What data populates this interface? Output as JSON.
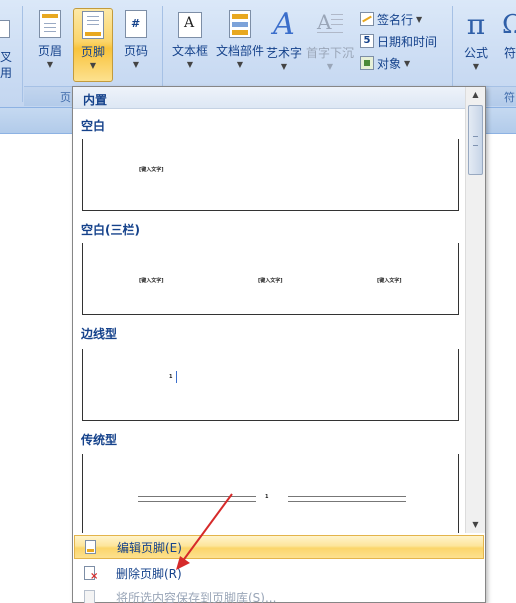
{
  "ribbon": {
    "left_cut_labels": [
      "叉",
      "用"
    ],
    "buttons": {
      "header": "页眉",
      "footer": "页脚",
      "page_number": "页码",
      "textbox": "文本框",
      "quick_parts": "文档部件",
      "wordart": "艺术字",
      "dropcap": "首字下沉",
      "equation": "公式",
      "symbol_cut": "符"
    },
    "small_buttons": {
      "signature_line": "签名行",
      "date_time": "日期和时间",
      "object": "对象"
    },
    "group_labels": {
      "header_footer_cut": "页",
      "symbols_cut": "符"
    }
  },
  "dropdown": {
    "header": "内置",
    "sections": [
      {
        "title": "空白",
        "placeholders": [
          "[键入文字]"
        ]
      },
      {
        "title": "空白(三栏)",
        "placeholders": [
          "[键入文字]",
          "[键入文字]",
          "[键入文字]"
        ]
      },
      {
        "title": "边线型",
        "placeholders": [
          "1"
        ]
      },
      {
        "title": "传统型",
        "placeholders": [
          "1"
        ]
      }
    ],
    "menu": [
      {
        "label": "编辑页脚(E)",
        "state": "hover"
      },
      {
        "label": "删除页脚(R)",
        "state": "normal"
      },
      {
        "label": "将所选内容保存到页脚库(S)...",
        "state": "disabled"
      }
    ]
  },
  "colors": {
    "ribbon_bg": "#cbdcf3",
    "active_button": "#fbd56b",
    "text": "#15428b",
    "annotation_arrow": "#d62a2a"
  }
}
